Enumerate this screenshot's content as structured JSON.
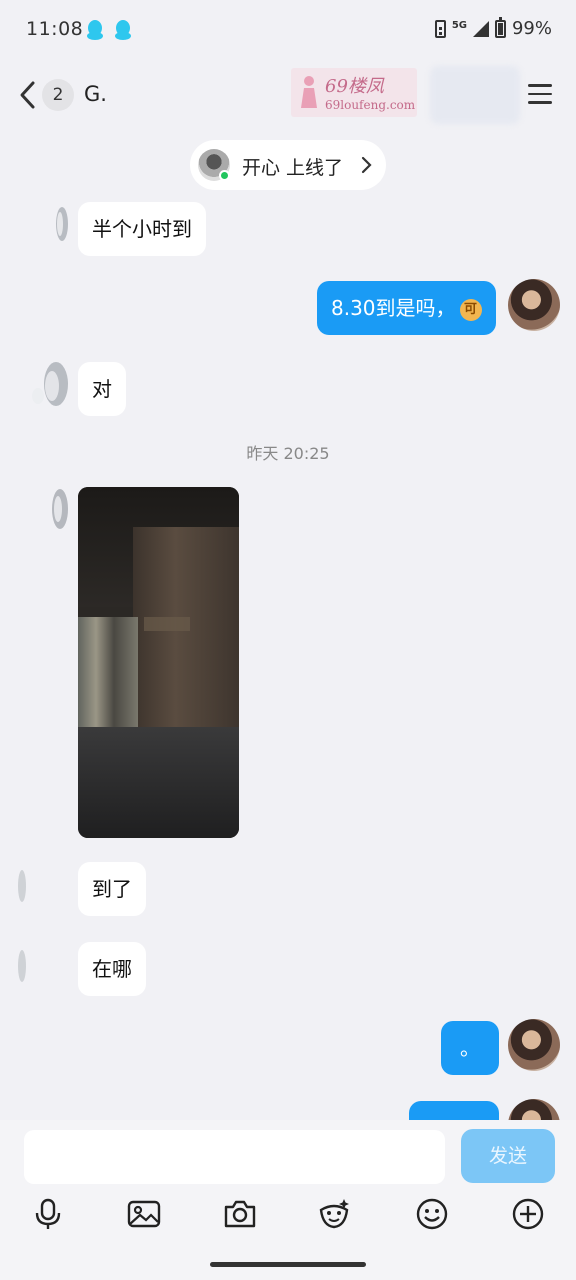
{
  "status_bar": {
    "time": "11:08",
    "network": "5G",
    "battery": "99%"
  },
  "header": {
    "unread_count": "2",
    "title": "G.",
    "watermark_title": "69楼凤",
    "watermark_url": "69loufeng.com"
  },
  "online_notice": {
    "text": "开心 上线了"
  },
  "messages": [
    {
      "side": "in",
      "text": "半个小时到"
    },
    {
      "side": "out",
      "text": "8.30到是吗，",
      "emoji": "可"
    },
    {
      "side": "in",
      "text": "对"
    },
    {
      "side": "in",
      "text": "到了"
    },
    {
      "side": "in",
      "text": "在哪"
    },
    {
      "side": "out",
      "text": "。"
    },
    {
      "side": "out",
      "text": ""
    }
  ],
  "time_divider": "昨天 20:25",
  "composer": {
    "placeholder": "",
    "send_label": "发送"
  },
  "toolbar": {
    "icons": [
      "microphone-icon",
      "image-icon",
      "camera-icon",
      "sticker-icon",
      "emoji-icon",
      "plus-icon"
    ]
  },
  "colors": {
    "outgoing_bubble": "#1a9bf5",
    "incoming_bubble": "#ffffff",
    "send_button": "#7cc6f6",
    "background": "#f1f1f5"
  }
}
